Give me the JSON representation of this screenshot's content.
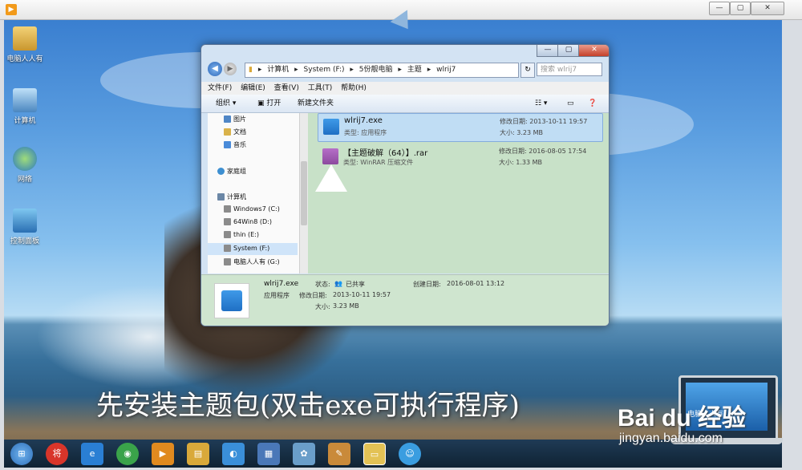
{
  "player": {
    "logo_icon": "player-logo-icon",
    "minimize": "—",
    "restore": "▢",
    "close": "✕"
  },
  "desktop_icons": [
    {
      "label": "电脑人人有",
      "icon": "user-folder-icon"
    },
    {
      "label": "计算机",
      "icon": "computer-icon"
    },
    {
      "label": "网络",
      "icon": "network-icon"
    },
    {
      "label": "控制面板",
      "icon": "control-panel-icon"
    }
  ],
  "explorer": {
    "window_buttons": {
      "minimize": "—",
      "maximize": "▢",
      "close": "✕"
    },
    "address": {
      "segments": [
        "计算机",
        "System (F:)",
        "5份靓电脑",
        "主题",
        "wlrij7"
      ],
      "separator": "▸"
    },
    "search_placeholder": "搜索 wlrij7",
    "menu": [
      "文件(F)",
      "编辑(E)",
      "查看(V)",
      "工具(T)",
      "帮助(H)"
    ],
    "commands": {
      "organize": "组织 ▾",
      "open": "打开",
      "new_folder": "新建文件夹"
    },
    "nav_pane": [
      {
        "label": "图片",
        "color": "#4f86c6"
      },
      {
        "label": "文档",
        "color": "#d9b24a"
      },
      {
        "label": "音乐",
        "color": "#4a8bd9"
      },
      {
        "label": "家庭组",
        "color": "#3d8fd1"
      },
      {
        "label": "计算机",
        "color": "#6b87a6"
      },
      {
        "label": "Windows7 (C:)",
        "color": "#8b8b8b"
      },
      {
        "label": "64Win8  (D:)",
        "color": "#8b8b8b"
      },
      {
        "label": "thin (E:)",
        "color": "#8b8b8b"
      },
      {
        "label": "System (F:)",
        "color": "#8b8b8b"
      },
      {
        "label": "电脑人人有 (G:)",
        "color": "#8b8b8b"
      }
    ],
    "files": [
      {
        "name": "wlrij7.exe",
        "type": "类型: 应用程序",
        "date": "修改日期: 2013-10-11 19:57",
        "size": "大小: 3.23 MB",
        "selected": true,
        "icon_color": "#1f6fc4"
      },
      {
        "name": "【主题破解（64）】.rar",
        "type": "类型: WinRAR 压缩文件",
        "date": "修改日期: 2016-08-05 17:54",
        "size": "大小: 1.33 MB",
        "selected": false,
        "icon_color": "#8c4a9e"
      }
    ],
    "details": {
      "name": "wlrij7.exe",
      "type": "应用程序",
      "status_label": "状态:",
      "status_value": "已共享",
      "modified_label": "修改日期:",
      "modified_value": "2013-10-11 19:57",
      "created_label": "创建日期:",
      "created_value": "2016-08-01 13:12",
      "size_label": "大小:",
      "size_value": "3.23 MB"
    }
  },
  "taskbar": [
    {
      "icon": "start-orb-icon",
      "glyph": "⊞",
      "color": "#2f6fb8"
    },
    {
      "icon": "app-red-icon",
      "glyph": "将",
      "color": "#d8352a"
    },
    {
      "icon": "ie-icon",
      "glyph": "e",
      "color": "#2a7fd4"
    },
    {
      "icon": "chrome-icon",
      "glyph": "◉",
      "color": "#3aa34a"
    },
    {
      "icon": "media-icon",
      "glyph": "▶",
      "color": "#e08a1f"
    },
    {
      "icon": "folder-icon",
      "glyph": "▤",
      "color": "#d9a93a"
    },
    {
      "icon": "app-icon",
      "glyph": "◐",
      "color": "#3a8fd9"
    },
    {
      "icon": "theme-icon",
      "glyph": "▦",
      "color": "#4a78b8"
    },
    {
      "icon": "settings-icon",
      "glyph": "✿",
      "color": "#6a9ec9"
    },
    {
      "icon": "paint-icon",
      "glyph": "✎",
      "color": "#c98a3a"
    },
    {
      "icon": "explorer-icon",
      "glyph": "▭",
      "color": "#e3c255"
    },
    {
      "icon": "chat-icon",
      "glyph": "☺",
      "color": "#3a9de0"
    }
  ],
  "caption": "先安装主题包(双击exe可执行程序)",
  "watermark": {
    "baidu": "Bai du 经验",
    "url": "jingyan.baidu.com",
    "laptop_text": "电脑人人有"
  }
}
